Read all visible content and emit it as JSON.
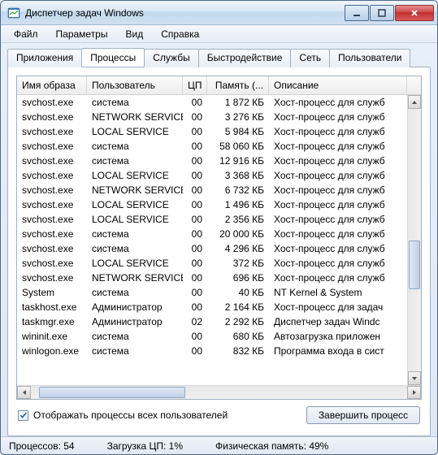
{
  "title": "Диспетчер задач Windows",
  "menu": [
    "Файл",
    "Параметры",
    "Вид",
    "Справка"
  ],
  "tabs": [
    "Приложения",
    "Процессы",
    "Службы",
    "Быстродействие",
    "Сеть",
    "Пользователи"
  ],
  "active_tab_index": 1,
  "columns": {
    "image": "Имя образа",
    "user": "Пользователь",
    "cpu": "ЦП",
    "mem": "Память (...",
    "desc": "Описание"
  },
  "rows": [
    {
      "image": "svchost.exe",
      "user": "система",
      "cpu": "00",
      "mem": "1 872 КБ",
      "desc": "Хост-процесс для служб"
    },
    {
      "image": "svchost.exe",
      "user": "NETWORK SERVICE",
      "cpu": "00",
      "mem": "3 276 КБ",
      "desc": "Хост-процесс для служб"
    },
    {
      "image": "svchost.exe",
      "user": "LOCAL SERVICE",
      "cpu": "00",
      "mem": "5 984 КБ",
      "desc": "Хост-процесс для служб"
    },
    {
      "image": "svchost.exe",
      "user": "система",
      "cpu": "00",
      "mem": "58 060 КБ",
      "desc": "Хост-процесс для служб"
    },
    {
      "image": "svchost.exe",
      "user": "система",
      "cpu": "00",
      "mem": "12 916 КБ",
      "desc": "Хост-процесс для служб"
    },
    {
      "image": "svchost.exe",
      "user": "LOCAL SERVICE",
      "cpu": "00",
      "mem": "3 368 КБ",
      "desc": "Хост-процесс для служб"
    },
    {
      "image": "svchost.exe",
      "user": "NETWORK SERVICE",
      "cpu": "00",
      "mem": "6 732 КБ",
      "desc": "Хост-процесс для служб"
    },
    {
      "image": "svchost.exe",
      "user": "LOCAL SERVICE",
      "cpu": "00",
      "mem": "1 496 КБ",
      "desc": "Хост-процесс для служб"
    },
    {
      "image": "svchost.exe",
      "user": "LOCAL SERVICE",
      "cpu": "00",
      "mem": "2 356 КБ",
      "desc": "Хост-процесс для служб"
    },
    {
      "image": "svchost.exe",
      "user": "система",
      "cpu": "00",
      "mem": "20 000 КБ",
      "desc": "Хост-процесс для служб"
    },
    {
      "image": "svchost.exe",
      "user": "система",
      "cpu": "00",
      "mem": "4 296 КБ",
      "desc": "Хост-процесс для служб"
    },
    {
      "image": "svchost.exe",
      "user": "LOCAL SERVICE",
      "cpu": "00",
      "mem": "372 КБ",
      "desc": "Хост-процесс для служб"
    },
    {
      "image": "svchost.exe",
      "user": "NETWORK SERVICE",
      "cpu": "00",
      "mem": "696 КБ",
      "desc": "Хост-процесс для служб"
    },
    {
      "image": "System",
      "user": "система",
      "cpu": "00",
      "mem": "40 КБ",
      "desc": "NT Kernel & System"
    },
    {
      "image": "taskhost.exe",
      "user": "Администратор",
      "cpu": "00",
      "mem": "2 164 КБ",
      "desc": "Хост-процесс для задач"
    },
    {
      "image": "taskmgr.exe",
      "user": "Администратор",
      "cpu": "02",
      "mem": "2 292 КБ",
      "desc": "Диспетчер задач Windc"
    },
    {
      "image": "wininit.exe",
      "user": "система",
      "cpu": "00",
      "mem": "680 КБ",
      "desc": "Автозагрузка приложен"
    },
    {
      "image": "winlogon.exe",
      "user": "система",
      "cpu": "00",
      "mem": "832 КБ",
      "desc": "Программа входа в сист"
    }
  ],
  "checkbox_label": "Отображать процессы всех пользователей",
  "end_process_btn": "Завершить процесс",
  "status": {
    "processes_label": "Процессов:",
    "processes_value": "54",
    "cpu_label": "Загрузка ЦП:",
    "cpu_value": "1%",
    "mem_label": "Физическая память:",
    "mem_value": "49%"
  }
}
